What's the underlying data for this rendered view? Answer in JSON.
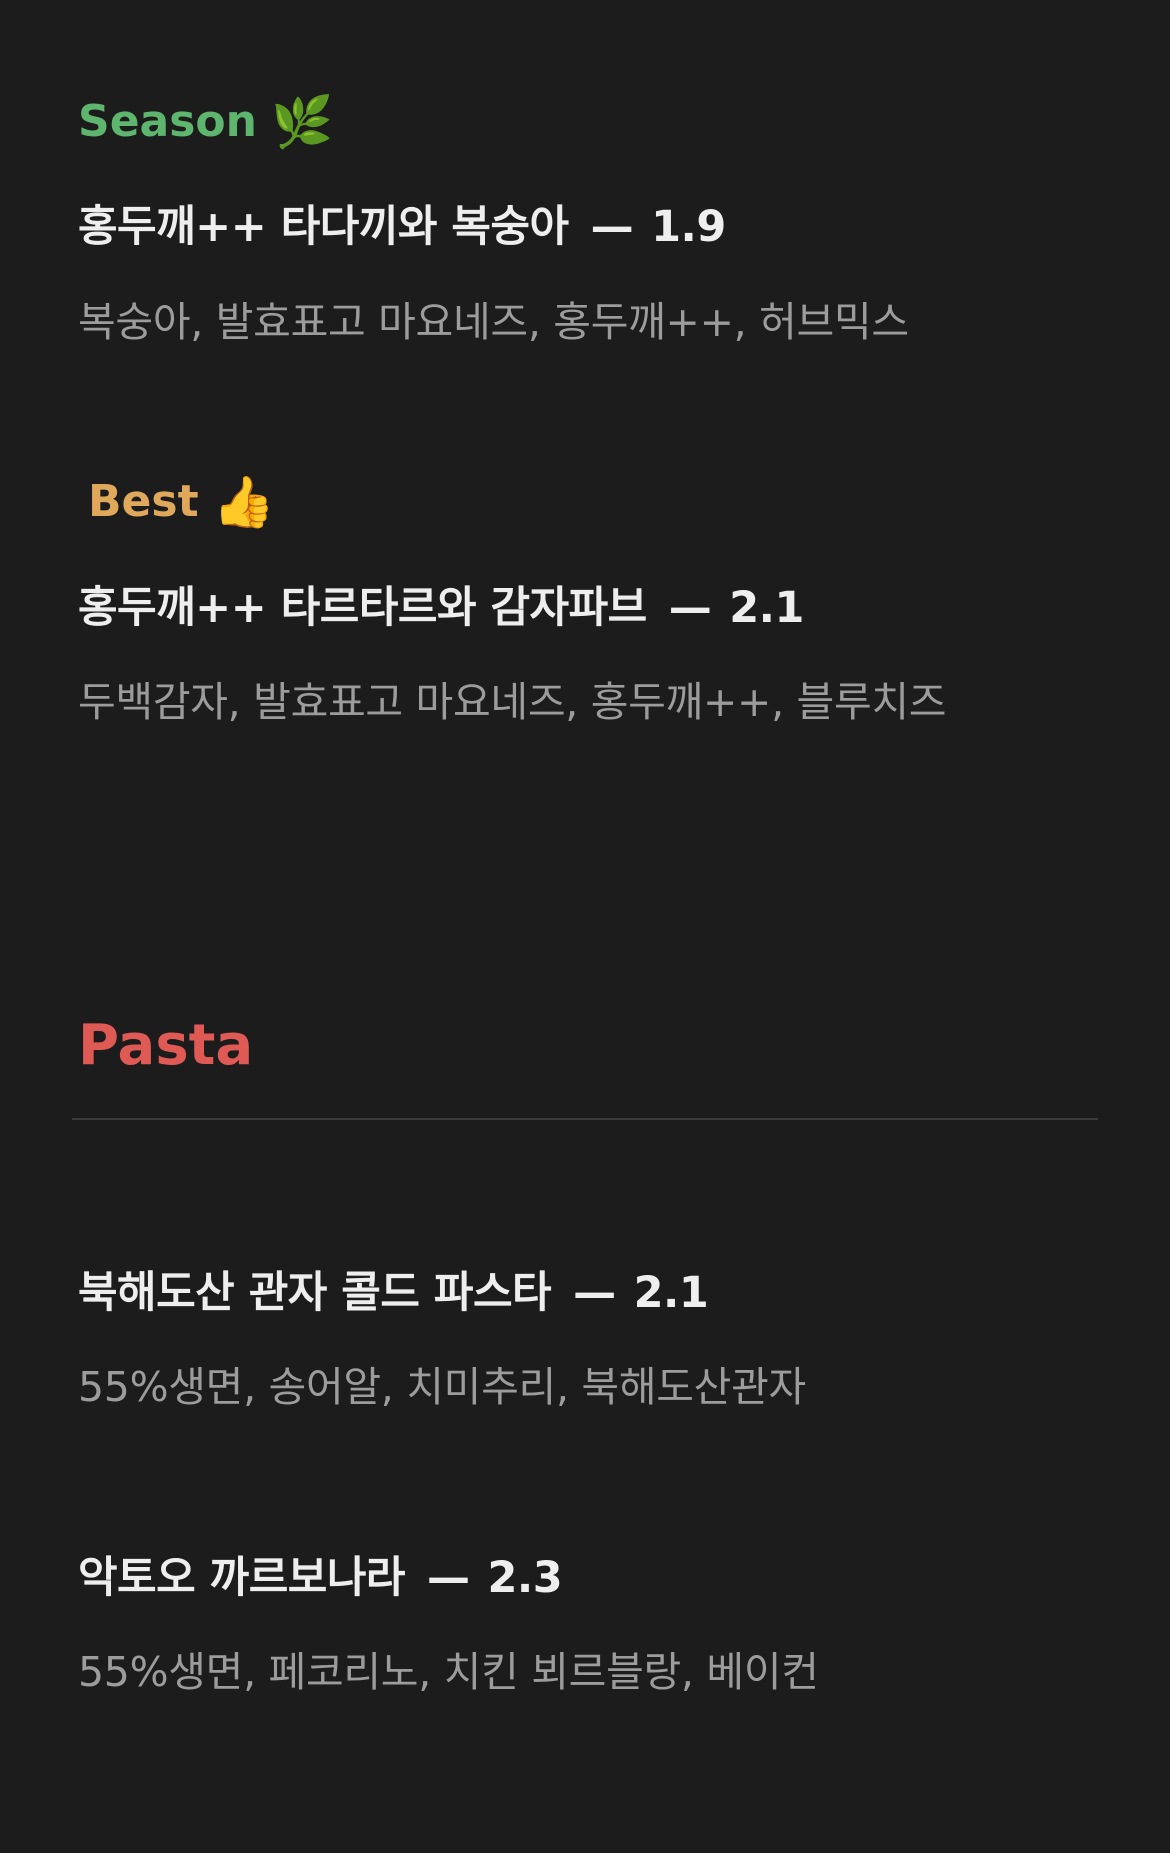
{
  "colors": {
    "background": "#1c1c1c",
    "season": "#5db56e",
    "best": "#e0a85a",
    "pasta": "#e05a55",
    "title": "#eeeeee",
    "description": "#9c9c9c"
  },
  "season": {
    "label": "Season",
    "icon": "herb-icon",
    "emoji": "🌿",
    "item": {
      "name": "홍두깨++ 타다끼와 복숭아",
      "dash": "—",
      "price": "1.9",
      "description": "복숭아, 발효표고 마요네즈, 홍두깨++, 허브믹스"
    }
  },
  "best": {
    "label": "Best",
    "icon": "thumbs-up-icon",
    "emoji": "👍",
    "item": {
      "name": "홍두깨++ 타르타르와 감자파브",
      "dash": "—",
      "price": "2.1",
      "description": "두백감자, 발효표고 마요네즈, 홍두깨++, 블루치즈"
    }
  },
  "pasta": {
    "title": "Pasta",
    "items": [
      {
        "name": "북해도산 관자 콜드 파스타",
        "dash": "—",
        "price": "2.1",
        "description": "55%생면, 송어알, 치미추리, 북해도산관자"
      },
      {
        "name": "악토오 까르보나라",
        "dash": "—",
        "price": "2.3",
        "description": "55%생면, 페코리노, 치킨 뵈르블랑, 베이컨"
      }
    ]
  }
}
